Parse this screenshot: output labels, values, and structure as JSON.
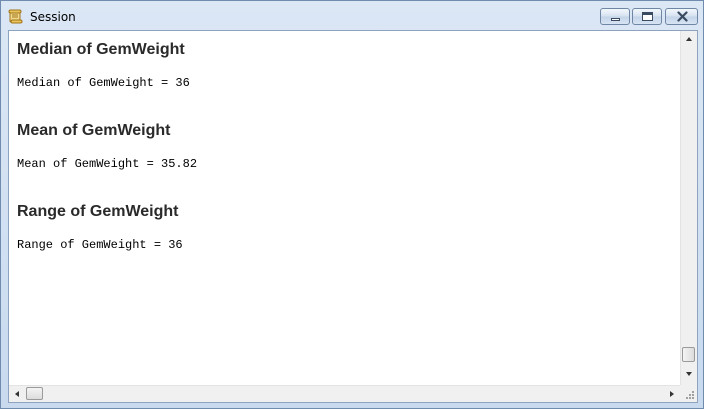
{
  "window": {
    "title": "Session",
    "app_icon": "scroll-icon",
    "controls": [
      "minimize-icon",
      "maximize-icon",
      "close-icon"
    ]
  },
  "sections": [
    {
      "heading": "Median of GemWeight",
      "result": "Median of GemWeight = 36"
    },
    {
      "heading": "Mean of GemWeight",
      "result": "Mean of GemWeight = 35.82"
    },
    {
      "heading": "Range of GemWeight",
      "result": "Range of GemWeight = 36"
    }
  ],
  "scrollbars": {
    "vertical_position": 1.0,
    "horizontal_position": 0.0
  },
  "colors": {
    "titlebar": "#c9daef",
    "heading_text": "#2a2a2a"
  }
}
